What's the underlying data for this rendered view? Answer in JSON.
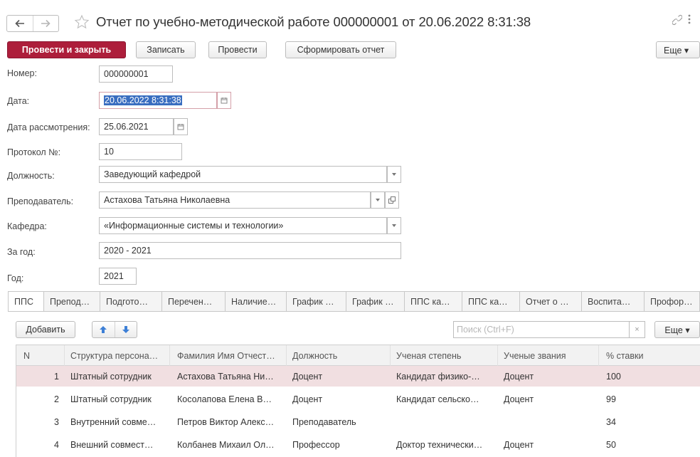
{
  "window": {
    "title": "Отчет по учебно-методической работе 000000001 от 20.06.2022 8:31:38"
  },
  "toolbar": {
    "post_close": "Провести и закрыть",
    "save": "Записать",
    "post": "Провести",
    "report": "Сформировать отчет",
    "more": "Еще ▾"
  },
  "form": {
    "number": {
      "label": "Номер:",
      "value": "000000001"
    },
    "date": {
      "label": "Дата:",
      "value": "20.06.2022  8:31:38"
    },
    "review_date": {
      "label": "Дата рассмотрения:",
      "value": "25.06.2021"
    },
    "protocol": {
      "label": "Протокол №:",
      "value": "10"
    },
    "position": {
      "label": "Должность:",
      "value": "Заведующий кафедрой"
    },
    "teacher": {
      "label": "Преподаватель:",
      "value": "Астахова Татьяна Николаевна"
    },
    "department": {
      "label": "Кафедра:",
      "value": "«Информационные системы и технологии»"
    },
    "for_year": {
      "label": "За год:",
      "value": "2020 - 2021"
    },
    "year": {
      "label": "Год:",
      "value": "2021"
    }
  },
  "tabs": [
    "ППС",
    "Препод…",
    "Подгото…",
    "Перечен…",
    "Наличие…",
    "График …",
    "График …",
    "ППС ка…",
    "ППС ка…",
    "Отчет о …",
    "Воспита…",
    "Профор…"
  ],
  "table_toolbar": {
    "add": "Добавить",
    "search_placeholder": "Поиск (Ctrl+F)",
    "clear": "×",
    "more": "Еще ▾"
  },
  "table": {
    "columns": [
      "N",
      "Структура персона…",
      "Фамилия Имя Отчест…",
      "Должность",
      "Ученая степень",
      "Ученые звания",
      "% ставки"
    ],
    "rows": [
      [
        "1",
        "Штатный сотрудник",
        "Астахова Татьяна Ни…",
        "Доцент",
        "Кандидат физико-…",
        "Доцент",
        "100"
      ],
      [
        "2",
        "Штатный сотрудник",
        "Косолапова Елена В…",
        "Доцент",
        "Кандидат сельско…",
        "Доцент",
        "99"
      ],
      [
        "3",
        "Внутренний совме…",
        "Петров Виктор Алекс…",
        "Преподаватель",
        "",
        "",
        "34"
      ],
      [
        "4",
        "Внешний совмест…",
        "Колбанев Михаил Ол…",
        "Профессор",
        "Доктор технически…",
        "Доцент",
        "50"
      ]
    ]
  },
  "colors": {
    "primary": "#ad1e3b",
    "selected_row": "#f1dfe1",
    "selection": "#3a6ec0",
    "arrow": "#3d7fd6"
  }
}
